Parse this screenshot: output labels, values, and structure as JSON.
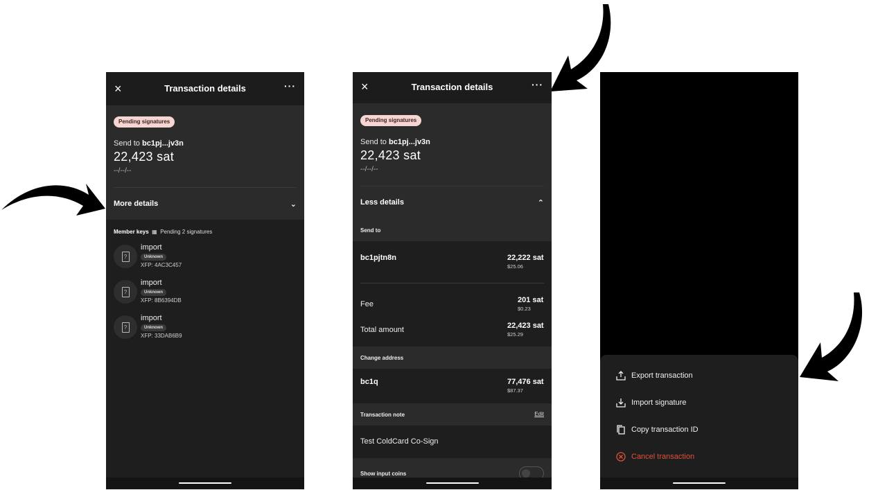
{
  "screens": [
    {
      "header": {
        "title": "Transaction details",
        "close_icon": "×",
        "more_icon": "···"
      },
      "badge": "Pending signatures",
      "send_to_prefix": "Send to ",
      "send_to_address": "bc1pj...jv3n",
      "amount": "22,423 sat",
      "date": "--/--/--",
      "details_toggle": "More details",
      "member_keys_label": "Member keys",
      "pending_text": "Pending 2 signatures",
      "members": [
        {
          "name": "import",
          "status": "Unknown",
          "xfp": "XFP: 4AC3C457"
        },
        {
          "name": "import",
          "status": "Unknown",
          "xfp": "XFP: 8B6394DB"
        },
        {
          "name": "import",
          "status": "Unknown",
          "xfp": "XFP: 33DAB6B9"
        }
      ]
    },
    {
      "header": {
        "title": "Transaction details",
        "close_icon": "×",
        "more_icon": "···"
      },
      "badge": "Pending signatures",
      "send_to_prefix": "Send to ",
      "send_to_address": "bc1pj...jv3n",
      "amount": "22,423 sat",
      "date": "--/--/--",
      "details_toggle": "Less details",
      "send_to_section": "Send to",
      "recipient": {
        "address": "bc1pjtn8n",
        "amount": "22,222 sat",
        "fiat": "$25.06"
      },
      "fee": {
        "label": "Fee",
        "amount": "201 sat",
        "fiat": "$0.23"
      },
      "total": {
        "label": "Total amount",
        "amount": "22,423 sat",
        "fiat": "$25.29"
      },
      "change_section": "Change address",
      "change": {
        "address": "bc1q",
        "amount": "77,476 sat",
        "fiat": "$87.37"
      },
      "note_section": "Transaction note",
      "note_edit": "Edit",
      "note_text": "Test ColdCard Co-Sign",
      "show_input_coins": "Show input coins"
    },
    {
      "menu": [
        {
          "label": "Export transaction",
          "icon": "export-icon"
        },
        {
          "label": "Import signature",
          "icon": "import-icon"
        },
        {
          "label": "Copy transaction ID",
          "icon": "copy-icon"
        },
        {
          "label": "Cancel transaction",
          "icon": "cancel-icon"
        }
      ]
    }
  ],
  "colors": {
    "badge": "#f6d5d3",
    "danger": "#e35038",
    "panel": "#2b2b2c",
    "background": "#1e1e1f"
  }
}
